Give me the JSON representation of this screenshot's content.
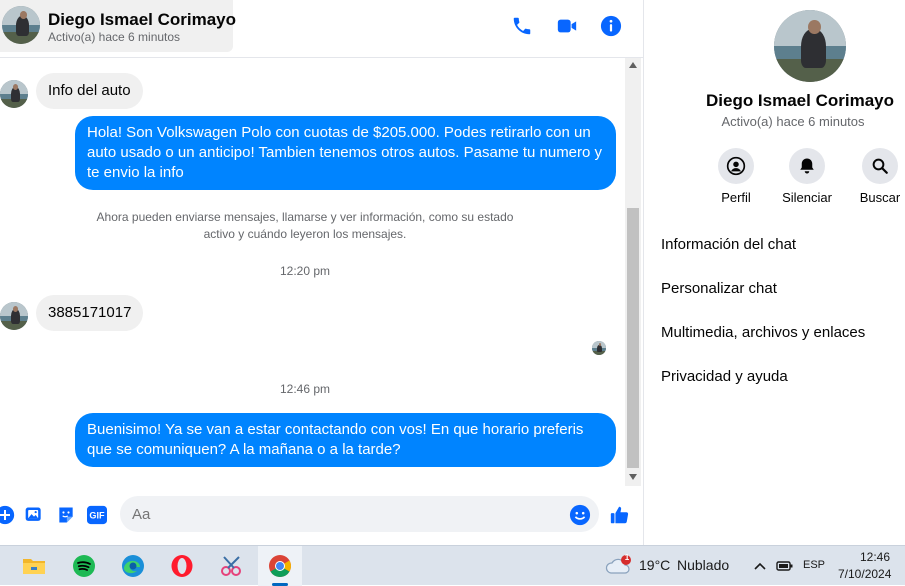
{
  "header": {
    "name": "Diego Ismael Corimayo",
    "status": "Activo(a) hace 6 minutos"
  },
  "messages": {
    "incoming_1": "Info del auto",
    "outgoing_1": "Hola! Son Volkswagen Polo con cuotas de $205.000. Podes retirarlo con un auto usado o un anticipo! Tambien tenemos otros autos. Pasame tu numero y te envio la info",
    "system_notice": "Ahora pueden enviarse mensajes, llamarse y ver información, como su estado activo y cuándo leyeron los mensajes.",
    "time_1": "12:20 pm",
    "incoming_2": "3885171017",
    "time_2": "12:46 pm",
    "outgoing_2": "Buenisimo! Ya se van a estar contactando con vos! En que horario preferis que se comuniquen? A la mañana o a la tarde?"
  },
  "composer": {
    "placeholder": "Aa"
  },
  "panel": {
    "name": "Diego Ismael Corimayo",
    "status": "Activo(a) hace 6 minutos",
    "actions": [
      {
        "label": "Perfil",
        "icon": "profile-icon"
      },
      {
        "label": "Silenciar",
        "icon": "bell-icon"
      },
      {
        "label": "Buscar",
        "icon": "search-icon"
      }
    ],
    "menu": [
      "Información del chat",
      "Personalizar chat",
      "Multimedia, archivos y enlaces",
      "Privacidad y ayuda"
    ]
  },
  "taskbar": {
    "apps": [
      "file-explorer-icon",
      "spotify-icon",
      "edge-icon",
      "opera-icon",
      "snipping-tool-icon",
      "chrome-icon"
    ],
    "weather_temp": "19°C",
    "weather_desc": "Nublado",
    "weather_badge": "1",
    "language": "ESP",
    "time": "12:46",
    "date": "7/10/2024"
  },
  "colors": {
    "accent": "#0084ff",
    "icon_blue": "#0866ff"
  }
}
